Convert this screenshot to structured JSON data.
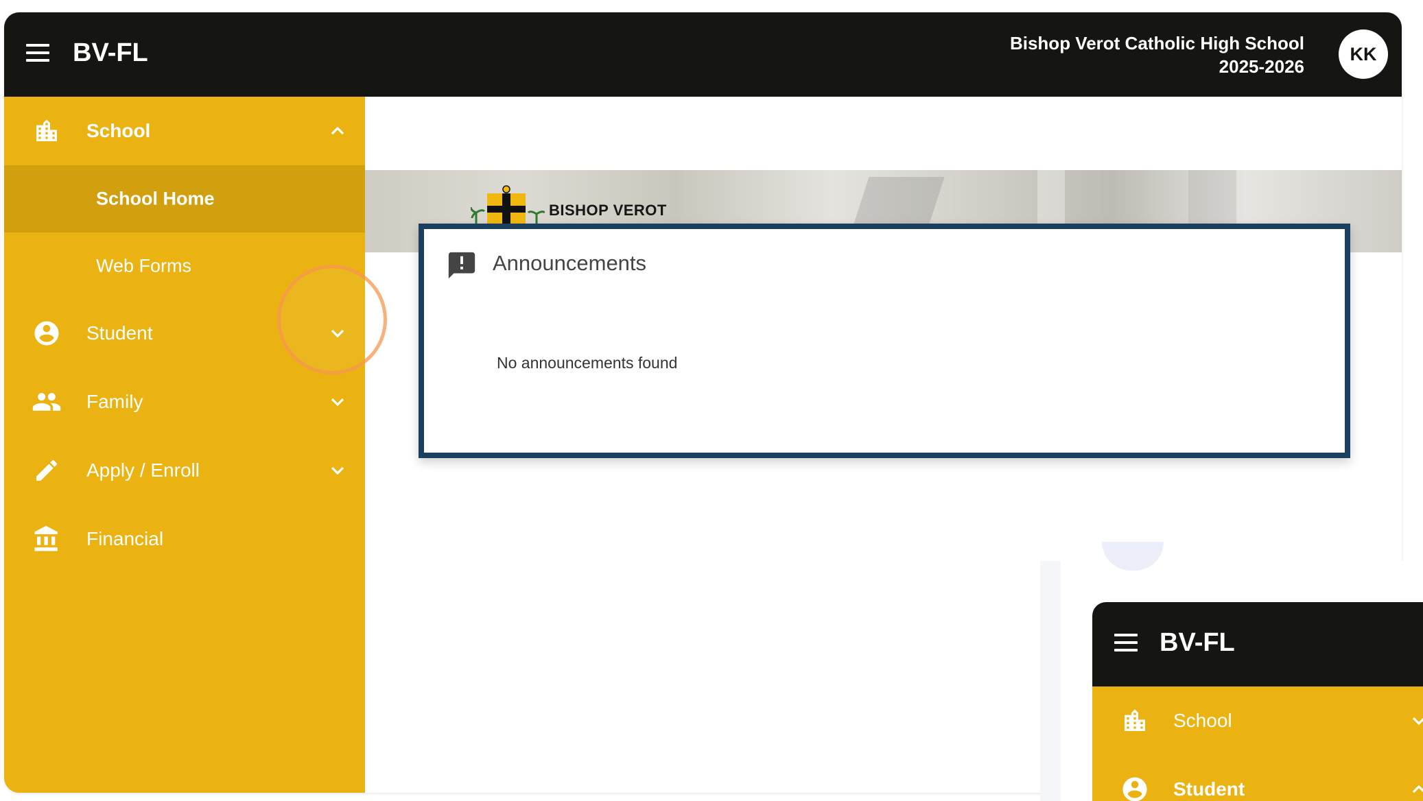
{
  "header": {
    "title": "BV-FL",
    "school_name": "Bishop Verot Catholic High School",
    "school_year": "2025-2026",
    "avatar_initials": "KK"
  },
  "sidebar": {
    "items": [
      {
        "label": "School",
        "icon": "building-icon",
        "expanded": true
      },
      {
        "label": "Student",
        "icon": "account-circle-icon",
        "expanded": false
      },
      {
        "label": "Family",
        "icon": "people-icon",
        "expanded": false
      },
      {
        "label": "Apply / Enroll",
        "icon": "pencil-icon",
        "expanded": false
      },
      {
        "label": "Financial",
        "icon": "bank-icon"
      }
    ],
    "school_subitems": [
      {
        "label": "School Home",
        "active": true
      },
      {
        "label": "Web Forms",
        "active": false
      }
    ]
  },
  "banner": {
    "logo_text": "BISHOP VEROT"
  },
  "announcements": {
    "title": "Announcements",
    "empty_message": "No announcements found",
    "icon": "announcement-icon"
  },
  "preview": {
    "title": "BV-FL",
    "items": [
      {
        "label": "School",
        "icon": "building-icon"
      },
      {
        "label": "Student",
        "icon": "account-circle-icon"
      }
    ]
  },
  "colors": {
    "topbar": "#151512",
    "sidebar": "#eab312",
    "sidebar_active": "#d29f0f",
    "card_border": "#1b3f5e",
    "click_ring": "#f7964e"
  }
}
